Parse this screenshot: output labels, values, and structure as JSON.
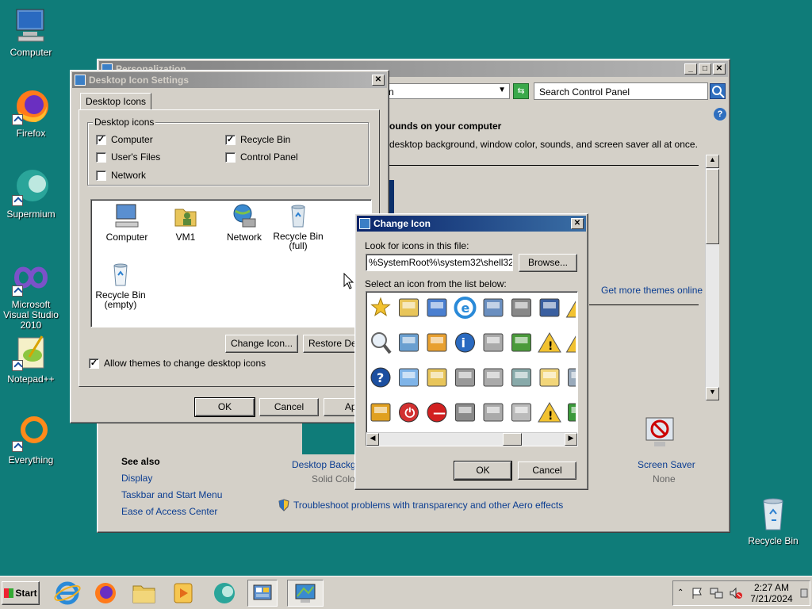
{
  "desktop": {
    "icons": [
      {
        "label": "Computer",
        "icon": "computer-icon"
      },
      {
        "label": "Firefox",
        "icon": "firefox-icon"
      },
      {
        "label": "Supermium",
        "icon": "supermium-icon"
      },
      {
        "label": "Microsoft Visual Studio 2010",
        "icon": "visual-studio-icon"
      },
      {
        "label": "Notepad++",
        "icon": "notepad-plus-plus-icon"
      },
      {
        "label": "Everything",
        "icon": "everything-icon"
      },
      {
        "label": "Recycle Bin",
        "icon": "recycle-bin-icon"
      }
    ]
  },
  "personalization": {
    "title": "Personalization",
    "address_partial": "n",
    "search_placeholder": "Search Control Panel",
    "heading": "ounds on your computer",
    "description": "desktop background, window color, sounds, and screen saver all at once.",
    "more_themes": "Get more themes online",
    "see_also_title": "See also",
    "see_also": [
      "Display",
      "Taskbar and Start Menu",
      "Ease of Access Center"
    ],
    "desktop_bg_label": "Desktop Backgro",
    "desktop_bg_value": "Solid Color",
    "screen_saver_label": "Screen Saver",
    "screen_saver_value": "None",
    "troubleshoot": "Troubleshoot problems with transparency and other Aero effects"
  },
  "desktop_icon_settings": {
    "title": "Desktop Icon Settings",
    "tab": "Desktop Icons",
    "group_label": "Desktop icons",
    "checkboxes": [
      {
        "label": "Computer",
        "checked": true
      },
      {
        "label": "Recycle Bin",
        "checked": true
      },
      {
        "label": "User's Files",
        "checked": false
      },
      {
        "label": "Control Panel",
        "checked": false
      },
      {
        "label": "Network",
        "checked": false
      }
    ],
    "preview_icons": [
      {
        "label": "Computer",
        "icon": "computer-icon"
      },
      {
        "label": "VM1",
        "icon": "user-folder-icon"
      },
      {
        "label": "Network",
        "icon": "network-icon"
      },
      {
        "label": "Recycle Bin (full)",
        "icon": "recycle-bin-full-icon"
      },
      {
        "label": "Recycle Bin (empty)",
        "icon": "recycle-bin-empty-icon"
      }
    ],
    "change_icon_btn": "Change Icon...",
    "restore_default_btn": "Restore Defa",
    "allow_themes": {
      "label": "Allow themes to change desktop icons",
      "checked": true
    },
    "ok": "OK",
    "cancel": "Cancel",
    "apply": "App"
  },
  "change_icon": {
    "title": "Change Icon",
    "look_label": "Look for icons in this file:",
    "file_value": "%SystemRoot%\\system32\\shell32.d",
    "browse": "Browse...",
    "select_label": "Select an icon from the list below:",
    "ok": "OK",
    "cancel": "Cancel",
    "icons": [
      "star-icon",
      "folder-calendar-icon",
      "document-check-icon",
      "internet-explorer-icon",
      "help-document-icon",
      "printer-network-icon",
      "computer-monitor-icon",
      "warning-partial-icon",
      "magnifier-icon",
      "network-computer-icon",
      "stack-up-icon",
      "info-icon",
      "printer-icon",
      "printer-green-icon",
      "warning-icon",
      "warning-partial-icon",
      "help-icon",
      "window-icon",
      "search-folder-icon",
      "printer-doc-icon",
      "printer-doc2-icon",
      "printer-net-icon",
      "folder-x-icon",
      "partial-icon",
      "key-icon",
      "shutdown-icon",
      "no-entry-icon",
      "tools-icon",
      "fax-printer-icon",
      "fax-icon",
      "warning-icon",
      "refresh-partial-icon"
    ]
  },
  "taskbar": {
    "start": "Start",
    "time": "2:27 AM",
    "date": "7/21/2024"
  }
}
